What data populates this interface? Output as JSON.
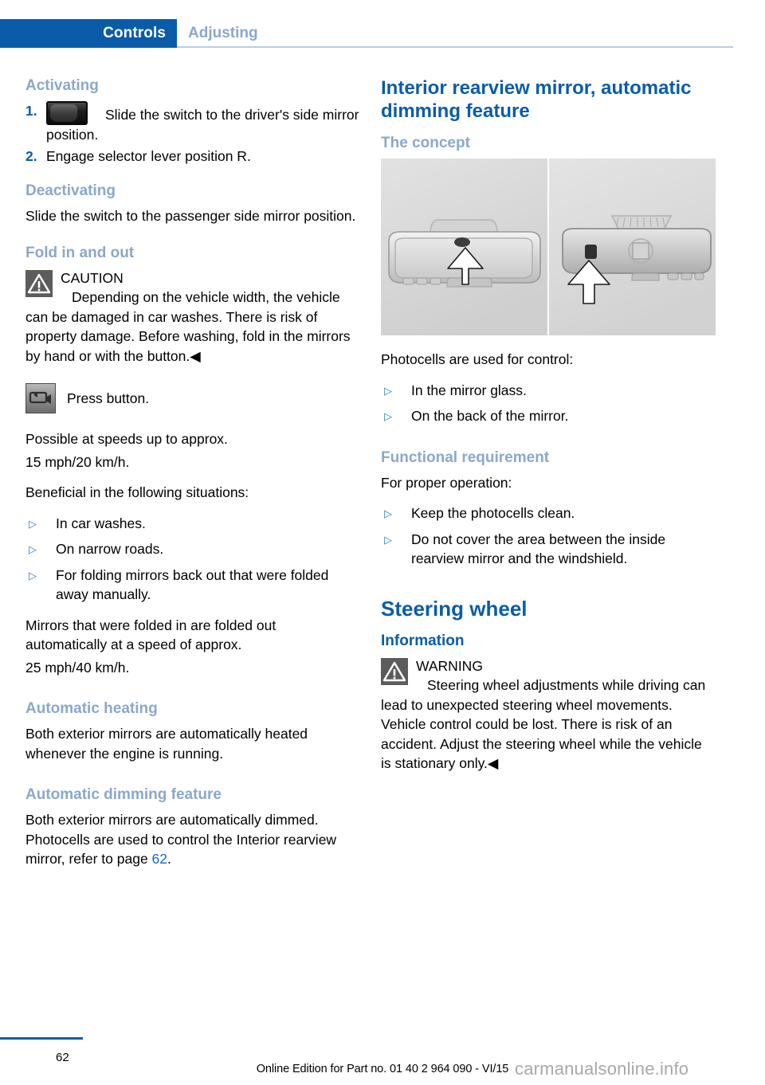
{
  "header": {
    "active_tab": "Controls",
    "inactive_tab": "Adjusting"
  },
  "left_column": {
    "activating": {
      "heading": "Activating",
      "steps": [
        {
          "num": "1.",
          "text": "Slide the switch to the driver's side mirror position.",
          "icon": "slide-switch-icon"
        },
        {
          "num": "2.",
          "text": "Engage selector lever position R."
        }
      ]
    },
    "deactivating": {
      "heading": "Deactivating",
      "body": "Slide the switch to the passenger side mirror position."
    },
    "fold_in_and_out": {
      "heading": "Fold in and out",
      "caution": {
        "label": "CAUTION",
        "text": "Depending on the vehicle width, the vehicle can be damaged in car washes. There is risk of property damage. Before washing, fold in the mirrors by hand or with the button.◀"
      },
      "button_row": {
        "icon": "mirror-fold-button-icon",
        "label": "Press button."
      },
      "speed_note_line1": "Possible at speeds up to approx.",
      "speed_note_line2": "15 mph/20 km/h.",
      "situations_intro": "Beneficial in the following situations:",
      "situations": [
        "In car washes.",
        "On narrow roads.",
        "For folding mirrors back out that were folded away manually."
      ],
      "autofold_line1": "Mirrors that were folded in are folded out automatically at a speed of approx.",
      "autofold_line2": "25 mph/40 km/h."
    },
    "automatic_heating": {
      "heading": "Automatic heating",
      "body": "Both exterior mirrors are automatically heated whenever the engine is running."
    },
    "automatic_dimming": {
      "heading": "Automatic dimming feature",
      "body_before": "Both exterior mirrors are automatically dimmed. Photocells are used to control the Interior rearview mirror, refer to page ",
      "page_ref": "62",
      "body_after": "."
    }
  },
  "right_column": {
    "interior_mirror": {
      "heading": "Interior rearview mirror, automatic dimming feature",
      "concept_heading": "The concept",
      "figure_caption": "interior-rearview-mirror-photocell-diagram",
      "photocells_intro": "Photocells are used for control:",
      "photocells": [
        "In the mirror glass.",
        "On the back of the mirror."
      ],
      "functional_heading": "Functional requirement",
      "functional_intro": "For proper operation:",
      "functional_items": [
        "Keep the photocells clean.",
        "Do not cover the area between the inside rearview mirror and the windshield."
      ]
    },
    "steering_wheel": {
      "heading": "Steering wheel",
      "information_heading": "Information",
      "warning": {
        "label": "WARNING",
        "text": "Steering wheel adjustments while driving can lead to unexpected steering wheel movements. Vehicle control could be lost. There is risk of an accident. Adjust the steering wheel while the vehicle is stationary only.◀"
      }
    }
  },
  "footer": {
    "page_number": "62",
    "edition": "Online Edition for Part no. 01 40 2 964 090 - VI/15",
    "watermark": "carmanualsonline.info"
  },
  "colors": {
    "brand_blue": "#0a5ca8",
    "light_blue": "#8aa8cc",
    "link_blue": "#1768c4",
    "bullet_blue": "#2b7bc4",
    "alert_gray": "#5c5c5c"
  }
}
